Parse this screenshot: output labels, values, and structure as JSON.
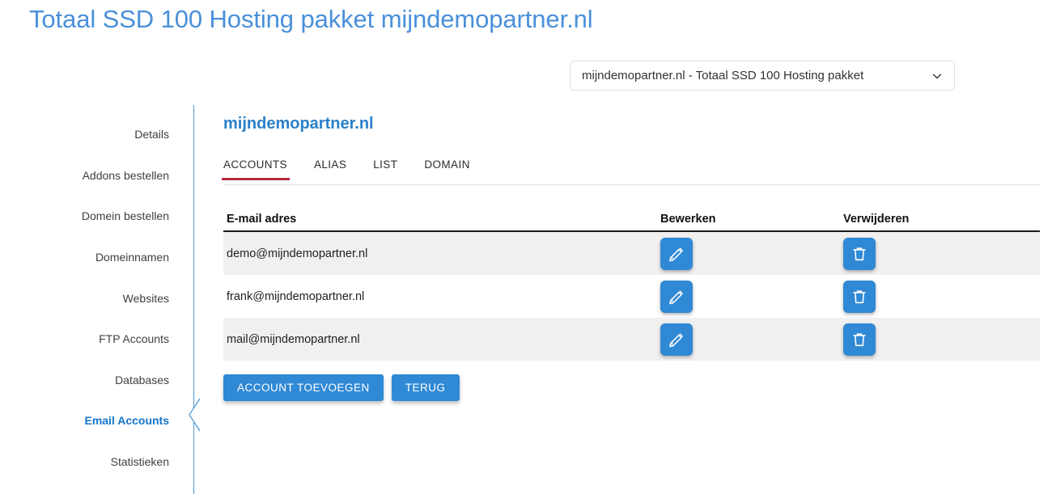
{
  "page": {
    "title": "Totaal SSD 100 Hosting pakket mijndemopartner.nl",
    "title_color": "#4a90d9"
  },
  "package_select": {
    "value": "mijndemopartner.nl - Totaal SSD 100 Hosting pakket",
    "chevron_icon": "chevron-down-icon"
  },
  "sidebar": {
    "items": [
      {
        "label": "Details",
        "active": false
      },
      {
        "label": "Addons bestellen",
        "active": false
      },
      {
        "label": "Domein bestellen",
        "active": false
      },
      {
        "label": "Domeinnamen",
        "active": false
      },
      {
        "label": "Websites",
        "active": false
      },
      {
        "label": "FTP Accounts",
        "active": false
      },
      {
        "label": "Databases",
        "active": false
      },
      {
        "label": "Email Accounts",
        "active": true
      },
      {
        "label": "Statistieken",
        "active": false
      }
    ],
    "active_color": "#1676c8",
    "divider_color": "#4e9bd8"
  },
  "content": {
    "domain_heading": "mijndemopartner.nl",
    "domain_heading_color": "#2b80c8",
    "tabs": [
      {
        "label": "ACCOUNTS",
        "active": true
      },
      {
        "label": "ALIAS",
        "active": false
      },
      {
        "label": "LIST",
        "active": false
      },
      {
        "label": "DOMAIN",
        "active": false
      }
    ],
    "tab_indicator_color": "#b42a40",
    "table": {
      "columns": [
        "E-mail adres",
        "Bewerken",
        "Verwijderen"
      ],
      "rows": [
        {
          "email": "demo@mijndemopartner.nl",
          "edit_icon": "pencil-icon",
          "delete_icon": "trash-icon"
        },
        {
          "email": "frank@mijndemopartner.nl",
          "edit_icon": "pencil-icon",
          "delete_icon": "trash-icon"
        },
        {
          "email": "mail@mijndemopartner.nl",
          "edit_icon": "pencil-icon",
          "delete_icon": "trash-icon"
        }
      ]
    },
    "buttons": {
      "add_account": "ACCOUNT TOEVOEGEN",
      "back": "TERUG",
      "color": "#3089d5"
    }
  }
}
